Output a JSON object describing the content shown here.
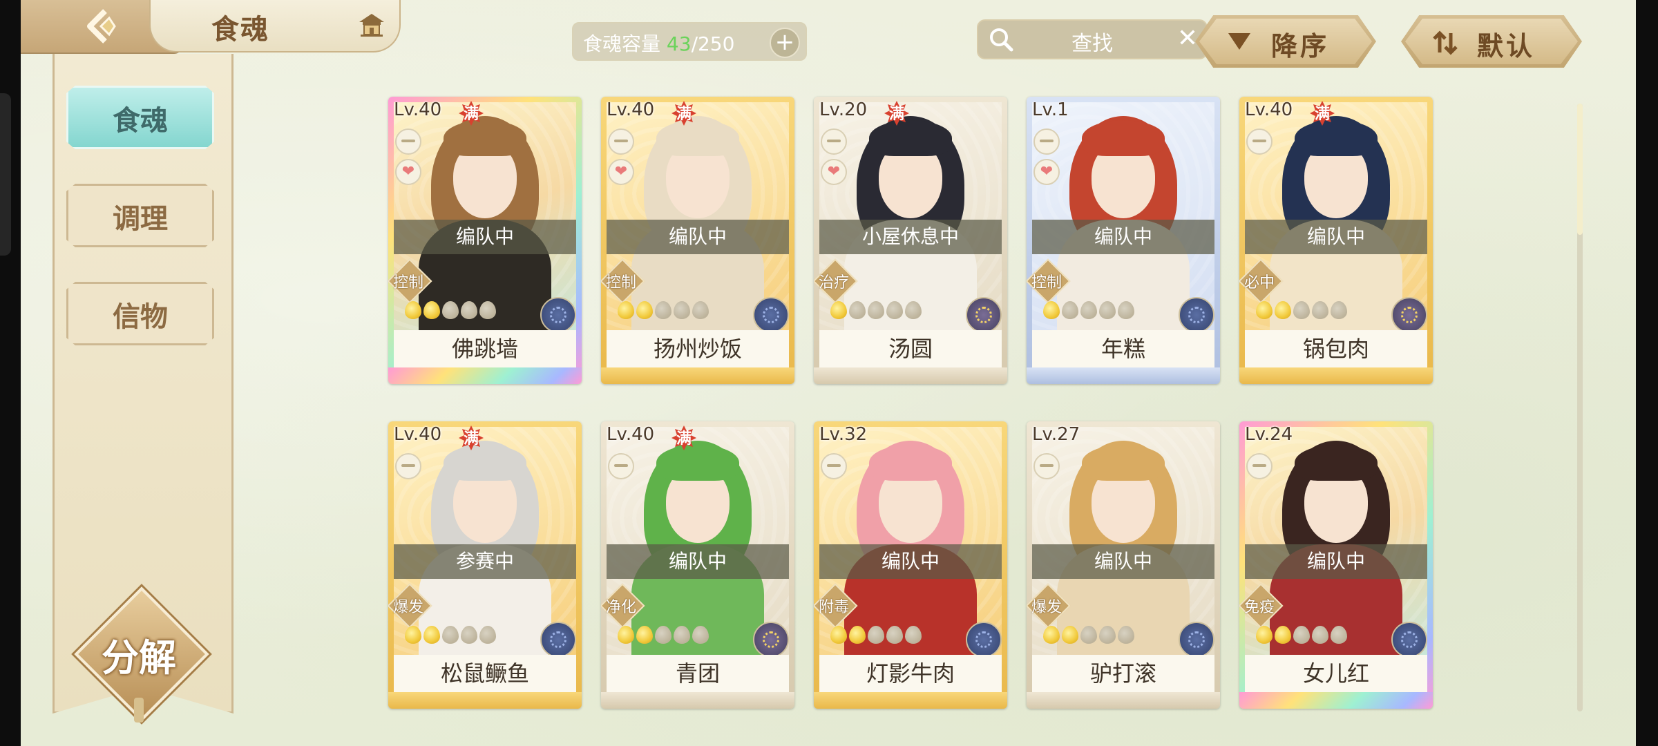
{
  "header": {
    "title": "食魂",
    "capacity_label": "食魂容量",
    "capacity_current": "43",
    "capacity_max": "/250",
    "capacity_add": "+",
    "search_placeholder": "查找",
    "search_clear": "✕",
    "sort_order_label": "降序",
    "sort_mode_label": "默认"
  },
  "sidebar": {
    "tabs": [
      {
        "label": "食魂",
        "active": true
      },
      {
        "label": "调理",
        "active": false
      },
      {
        "label": "信物",
        "active": false
      }
    ],
    "decompose_label": "分解"
  },
  "full_badge": "满",
  "cards": [
    {
      "level": "Lv.40",
      "full": true,
      "heart": true,
      "status": "编队中",
      "role": "控制",
      "stars_on": 2,
      "stars_total": 5,
      "element": "blue",
      "name": "佛跳墙",
      "rarity": "rainbow"
    },
    {
      "level": "Lv.40",
      "full": true,
      "heart": true,
      "status": "编队中",
      "role": "控制",
      "stars_on": 2,
      "stars_total": 5,
      "element": "blue",
      "name": "扬州炒饭",
      "rarity": "gold"
    },
    {
      "level": "Lv.20",
      "full": true,
      "heart": true,
      "status": "小屋休息中",
      "role": "治疗",
      "stars_on": 1,
      "stars_total": 5,
      "element": "gold",
      "name": "汤圆",
      "rarity": "white"
    },
    {
      "level": "Lv.1",
      "full": false,
      "heart": true,
      "status": "编队中",
      "role": "控制",
      "stars_on": 1,
      "stars_total": 5,
      "element": "blue",
      "name": "年糕",
      "rarity": "blue"
    },
    {
      "level": "Lv.40",
      "full": true,
      "heart": false,
      "status": "编队中",
      "role": "必中",
      "stars_on": 2,
      "stars_total": 5,
      "element": "gold",
      "name": "锅包肉",
      "rarity": "gold"
    },
    {
      "level": "Lv.40",
      "full": true,
      "heart": false,
      "status": "参赛中",
      "role": "爆发",
      "stars_on": 2,
      "stars_total": 5,
      "element": "blue",
      "name": "松鼠鳜鱼",
      "rarity": "gold"
    },
    {
      "level": "Lv.40",
      "full": true,
      "heart": false,
      "status": "编队中",
      "role": "净化",
      "stars_on": 2,
      "stars_total": 5,
      "element": "gold",
      "name": "青团",
      "rarity": "white"
    },
    {
      "level": "Lv.32",
      "full": false,
      "heart": false,
      "status": "编队中",
      "role": "附毒",
      "stars_on": 2,
      "stars_total": 5,
      "element": "blue",
      "name": "灯影牛肉",
      "rarity": "gold"
    },
    {
      "level": "Lv.27",
      "full": false,
      "heart": false,
      "status": "编队中",
      "role": "爆发",
      "stars_on": 2,
      "stars_total": 5,
      "element": "blue",
      "name": "驴打滚",
      "rarity": "white"
    },
    {
      "level": "Lv.24",
      "full": false,
      "heart": false,
      "status": "编队中",
      "role": "免疫",
      "stars_on": 2,
      "stars_total": 5,
      "element": "blue",
      "name": "女儿红",
      "rarity": "rainbow"
    }
  ],
  "colors": {
    "accent_teal": "#84d6cf",
    "gold_frame": "#e9b84a",
    "full_badge": "#d8412f",
    "capacity_current": "#6bd35b"
  }
}
